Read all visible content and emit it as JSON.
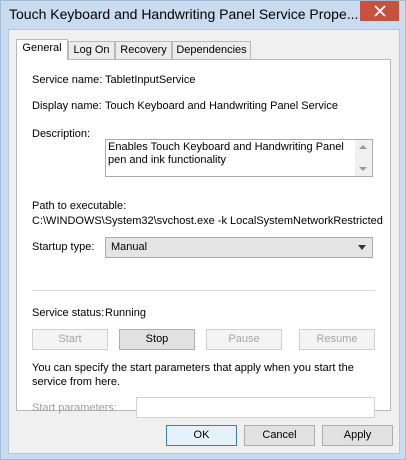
{
  "window": {
    "title": "Touch Keyboard and Handwriting Panel Service Prope...",
    "close_icon": "close-icon"
  },
  "tabs": [
    {
      "label": "General",
      "active": true
    },
    {
      "label": "Log On",
      "active": false
    },
    {
      "label": "Recovery",
      "active": false
    },
    {
      "label": "Dependencies",
      "active": false
    }
  ],
  "general": {
    "service_name_label": "Service name:",
    "service_name_value": "TabletInputService",
    "display_name_label": "Display name:",
    "display_name_value": "Touch Keyboard and Handwriting Panel Service",
    "description_label": "Description:",
    "description_value": "Enables Touch Keyboard and Handwriting Panel pen and ink functionality",
    "path_label": "Path to executable:",
    "path_value": "C:\\WINDOWS\\System32\\svchost.exe -k LocalSystemNetworkRestricted",
    "startup_type_label": "Startup type:",
    "startup_type_value": "Manual",
    "service_status_label": "Service status:",
    "service_status_value": "Running",
    "buttons": {
      "start": "Start",
      "stop": "Stop",
      "pause": "Pause",
      "resume": "Resume"
    },
    "note": "You can specify the start parameters that apply when you start the service from here.",
    "start_params_label": "Start parameters:",
    "start_params_value": ""
  },
  "footer": {
    "ok": "OK",
    "cancel": "Cancel",
    "apply": "Apply"
  }
}
